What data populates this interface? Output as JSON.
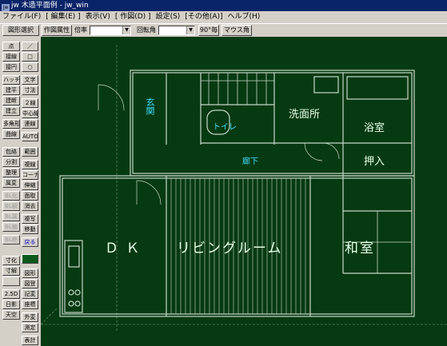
{
  "window": {
    "title": "jw 木造平面例 - jw_win"
  },
  "menu": [
    "ファイル(F)",
    "[ 編集(E) ]",
    "表示(V)",
    "[ 作図(D) ]",
    "設定(S)",
    "[その他(A)]",
    "ヘルプ(H)"
  ],
  "toolbar": {
    "select_button": "図形選択",
    "attr_button": "作図属性",
    "scale_label": "倍率",
    "scale_value": "",
    "angle_label": "回転角",
    "angle_value": "",
    "deg90_button": "90°毎",
    "mouse_angle_button": "マウス角"
  },
  "tools_col1": [
    "点",
    "接線",
    "接円",
    "ハッチ",
    "建平",
    "建断",
    "建立",
    "多角形",
    "曲線",
    "包絡",
    "分割",
    "整理",
    "属変",
    "BL化",
    "BL解",
    "BL属",
    "BL編",
    "BL終",
    "寸化",
    "寸解",
    "",
    "2.5D",
    "日影",
    "天空"
  ],
  "tools_col2": [
    "／",
    "□",
    "○",
    "文字",
    "寸法",
    "２線",
    "中心線",
    "連線",
    "AUTO",
    "範囲",
    "複線",
    "コーナー",
    "伸縮",
    "面取",
    "消去",
    "複写",
    "移動",
    "戻る",
    "",
    "図形",
    "図登",
    "記変",
    "座標",
    "外変",
    "測定",
    "表計"
  ],
  "rooms": {
    "genkan": "玄関",
    "toilet": "トイレ",
    "senmenjo": "洗面所",
    "yokushitsu": "浴室",
    "roka": "廊下",
    "oshiire": "押入",
    "dk": "Ｄ Ｋ",
    "living": "リビングルーム",
    "washitsu": "和室"
  },
  "colors": {
    "canvas": "#063a12",
    "wall": "#c8d8c8",
    "grid": "#7fa07f",
    "accent_cyan": "#3fe0ff"
  }
}
